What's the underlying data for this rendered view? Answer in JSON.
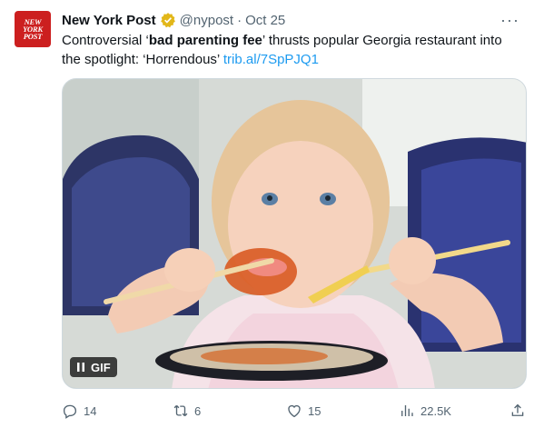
{
  "avatar": {
    "text_lines": [
      "NEW",
      "YORK",
      "POST"
    ],
    "bg_color": "#cc1f1f"
  },
  "header": {
    "name": "New York Post",
    "verified_icon": "verified-badge-gold",
    "handle": "@nypost",
    "separator": "·",
    "date": "Oct 25",
    "more": "···"
  },
  "tweet": {
    "text_before": "Controversial ‘",
    "text_bold": "bad parenting fee",
    "text_after": "’ thrusts popular Georgia restaurant into the spotlight: ‘Horrendous’ ",
    "link": "trib.al/7SpPJQ1"
  },
  "media": {
    "gif_label": "GIF",
    "pause_icon": "pause-icon"
  },
  "actions": {
    "replies": "14",
    "retweets": "6",
    "likes": "15",
    "views": "22.5K",
    "icons": [
      "reply-icon",
      "retweet-icon",
      "like-icon",
      "views-icon",
      "share-icon"
    ]
  },
  "colors": {
    "link": "#1d9bf0",
    "muted": "#536471",
    "text": "#0f1419",
    "verified": "#e2b719"
  }
}
